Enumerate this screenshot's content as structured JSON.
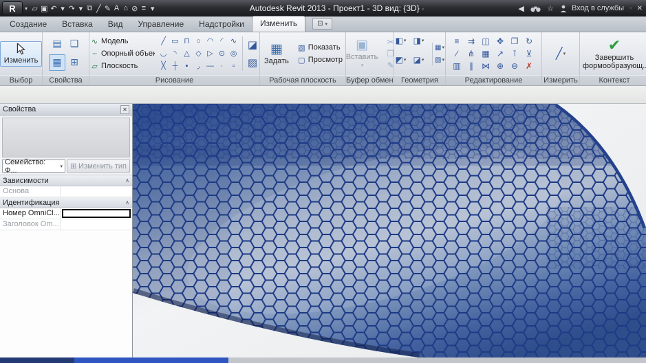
{
  "titlebar": {
    "app_button": "R",
    "app_caret": "▾",
    "qat": [
      "▱",
      "▣",
      "↶",
      "▾",
      "↷",
      "▾",
      "⧉",
      "╱",
      "✎",
      "A",
      "⌂",
      "⊘",
      "≡",
      "▾"
    ],
    "title": "Autodesk Revit 2013 - Проект1 - 3D вид: {3D}",
    "title_caret": "▾",
    "back": "◀",
    "star": "☆",
    "signin": "Вход в службы",
    "signin_caret": "▾",
    "close": "✕"
  },
  "tabs": [
    {
      "label": "Создание"
    },
    {
      "label": "Вставка"
    },
    {
      "label": "Вид"
    },
    {
      "label": "Управление"
    },
    {
      "label": "Надстройки"
    },
    {
      "label": "Изменить",
      "active": true
    }
  ],
  "tab_extra": {
    "icon": "⊡",
    "caret": "▾"
  },
  "ribbon": {
    "select": {
      "panel": "Выбор",
      "label": "Изменить"
    },
    "properties": {
      "panel": "Свойства",
      "grid": [
        "▤",
        "❏",
        "▦",
        "⊞"
      ]
    },
    "draw": {
      "panel": "Рисование",
      "items": [
        {
          "g": "∿",
          "label": "Модель"
        },
        {
          "g": "┄",
          "label": "Опорный объект"
        },
        {
          "g": "▱",
          "label": "Плоскость"
        }
      ],
      "grid": [
        "╱",
        "▭",
        "⊓",
        "○",
        "◠",
        "◜",
        "∿",
        "◡",
        "◝",
        "△",
        "◇",
        "▷",
        "⊙",
        "◎",
        "╳",
        "┼",
        "▪",
        "◞",
        "—",
        "·",
        "▫"
      ],
      "side": [
        "◪",
        "▨"
      ]
    },
    "workplane": {
      "panel": "Рабочая плоскость",
      "set": {
        "g": "▦",
        "label": "Задать"
      },
      "buttons": [
        {
          "g": "▧",
          "label": "Показать"
        },
        {
          "g": "▢",
          "label": "Просмотр"
        }
      ]
    },
    "clipboard": {
      "panel": "Буфер обмена",
      "paste": {
        "g": "▣",
        "label": "Вставить",
        "caret": "▾"
      },
      "side": [
        "✂",
        "❐",
        "✎"
      ]
    },
    "geometry": {
      "panel": "Геометрия",
      "items": [
        {
          "g": "◧",
          "c": "▾"
        },
        {
          "g": "◨",
          "c": "▾"
        },
        {
          "g": "◩",
          "c": "▾"
        },
        {
          "g": "◪",
          "c": "▾"
        }
      ],
      "side": [
        {
          "g": "▦",
          "c": "▾"
        },
        {
          "g": "▧",
          "c": "▾"
        }
      ]
    },
    "editing": {
      "panel": "Редактирование",
      "grid": [
        "≡",
        "⇉",
        "◫",
        "✥",
        "❐",
        "↻",
        "∕",
        "⋔",
        "▦",
        "↗",
        "⊺",
        "⊻",
        "▥",
        "∥",
        "⋈",
        "⊕",
        "⊖",
        {
          "g": "✗",
          "class": "red"
        }
      ]
    },
    "measure": {
      "panel": "Измерить",
      "main": {
        "g": "╱",
        "c": "▾"
      }
    },
    "context": {
      "panel": "Контекст",
      "check": "✔",
      "label": "Завершить формообразующ..."
    }
  },
  "properties_palette": {
    "title": "Свойства",
    "close": "✕",
    "family_select": "Семейство: Ф...",
    "select_caret": "▾",
    "edit_type_icon": "⊞",
    "edit_type": "Изменить тип",
    "sections": [
      {
        "name": "Зависимости",
        "chevron": "∧"
      },
      {
        "name": "Идентификация",
        "chevron": "∧"
      }
    ],
    "rows": {
      "base": {
        "label": "Основа",
        "value": ""
      },
      "omni_number": {
        "label": "Номер OmniCl...",
        "value": ""
      },
      "omni_title": {
        "label": "Заголовок Om...",
        "value": ""
      }
    }
  },
  "colors": {
    "band_blue": "#3d5a97",
    "silver_highlight": "#ccd1d9",
    "hex_stroke": "#1d3a85",
    "finish_green": "#2f9e3f",
    "progress_blue": "#2f55c0"
  }
}
